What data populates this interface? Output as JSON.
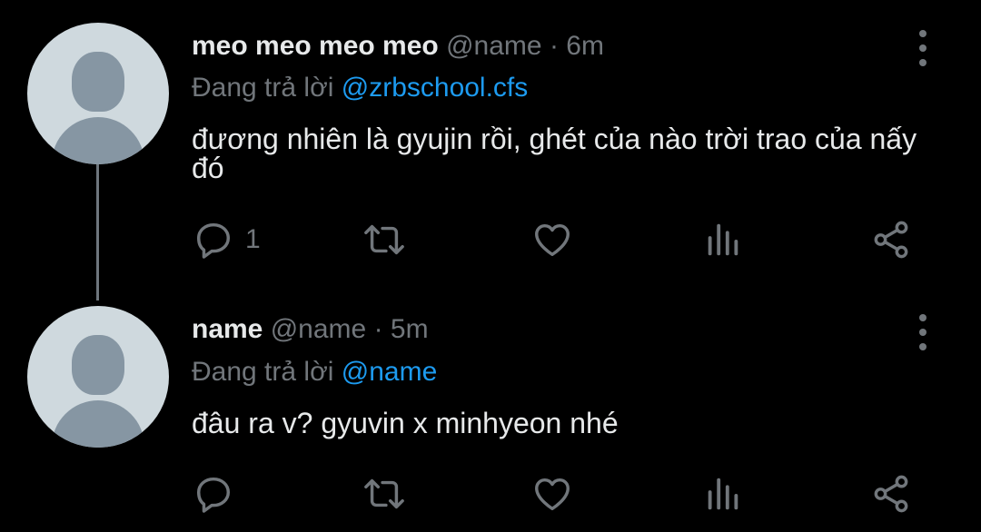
{
  "tweets": [
    {
      "display_name": "meo meo meo meo",
      "handle": "@name",
      "separator": "·",
      "time": "6m",
      "reply_prefix": "Đang trả lời",
      "reply_to": "@zrbschool.cfs",
      "text": "đương nhiên là gyujin rồi, ghét của nào trời trao của nấy đó",
      "reply_count": "1",
      "icons": [
        "reply-icon",
        "retweet-icon",
        "like-icon",
        "views-icon",
        "share-icon",
        "more-icon"
      ]
    },
    {
      "display_name": "name",
      "handle": "@name",
      "separator": "·",
      "time": "5m",
      "reply_prefix": "Đang trả lời",
      "reply_to": "@name",
      "text": "đâu ra v? gyuvin x minhyeon nhé",
      "reply_count": "",
      "icons": [
        "reply-icon",
        "retweet-icon",
        "like-icon",
        "views-icon",
        "share-icon",
        "more-icon"
      ]
    }
  ],
  "colors": {
    "background": "#000000",
    "primary_text": "#e7e9ea",
    "secondary_text": "#71767b",
    "accent": "#1d9bf0",
    "avatar_bg": "#cfd9de",
    "avatar_fg": "#8696a3"
  }
}
